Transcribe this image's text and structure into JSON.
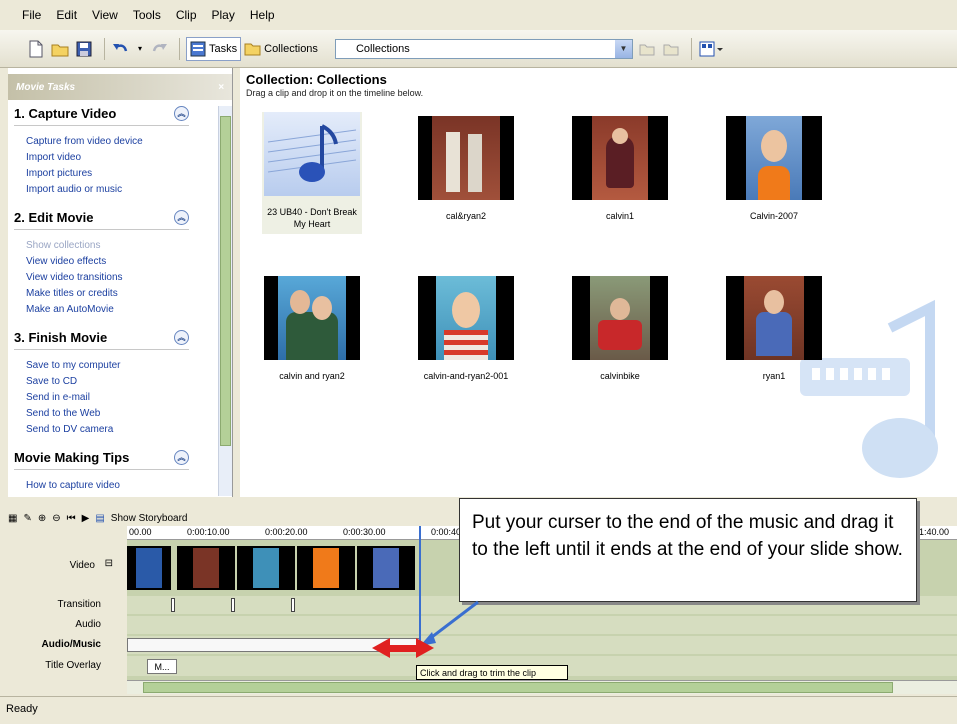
{
  "menu": [
    "File",
    "Edit",
    "View",
    "Tools",
    "Clip",
    "Play",
    "Help"
  ],
  "toolbar": {
    "tasks_label": "Tasks",
    "collections_label": "Collections",
    "collection_select": "Collections"
  },
  "tasks_panel": {
    "header": "Movie Tasks",
    "sections": [
      {
        "title": "1. Capture Video",
        "links": [
          "Capture from video device",
          "Import video",
          "Import pictures",
          "Import audio or music"
        ]
      },
      {
        "title": "2. Edit Movie",
        "links": [
          "Show collections",
          "View video effects",
          "View video transitions",
          "Make titles or credits",
          "Make an AutoMovie"
        ]
      },
      {
        "title": "3. Finish Movie",
        "links": [
          "Save to my computer",
          "Save to CD",
          "Send in e-mail",
          "Send to the Web",
          "Send to DV camera"
        ]
      },
      {
        "title": "Movie Making Tips",
        "links": [
          "How to capture video"
        ]
      }
    ]
  },
  "collection": {
    "title": "Collection: Collections",
    "subtitle": "Drag a clip and drop it on the timeline below.",
    "clips": [
      {
        "name": "23 UB40 - Don't Break My Heart"
      },
      {
        "name": "cal&ryan2"
      },
      {
        "name": "calvin1"
      },
      {
        "name": "Calvin-2007"
      },
      {
        "name": "calvin and ryan2"
      },
      {
        "name": "calvin-and-ryan2-001"
      },
      {
        "name": "calvinbike"
      },
      {
        "name": "ryan1"
      }
    ]
  },
  "timeline": {
    "show_storyboard": "Show Storyboard",
    "ruler_ticks": [
      "00.00",
      "0:00:10.00",
      "0:00:20.00",
      "0:00:30.00",
      "0:00:40",
      "1:40.00"
    ],
    "tracks": [
      "Video",
      "Transition",
      "Audio",
      "Audio/Music",
      "Title Overlay"
    ],
    "title_clip": "M...",
    "tooltip": "Click and drag to trim the clip"
  },
  "callout": "Put your curser to the end of the music and drag it to the left until it ends at the end of your slide show.",
  "status": "Ready",
  "colors": {
    "link": "#1b3fa0",
    "timeline_bg": "#c7d2ae",
    "arrow_red": "#e02020",
    "arrow_blue": "#3a6fd0"
  }
}
